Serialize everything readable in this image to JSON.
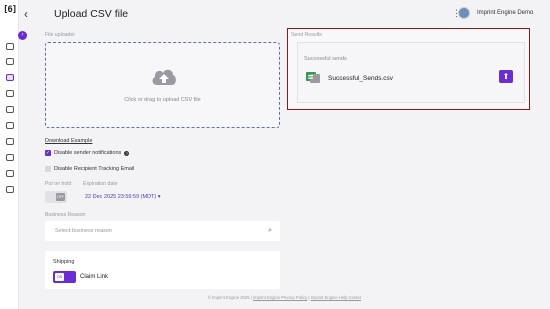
{
  "header": {
    "title": "Upload CSV file",
    "account_name": "Imprint Engine Demo",
    "logo_text": "[6]"
  },
  "sidebar": {
    "items": [
      "home-icon",
      "send-icon",
      "gift-icon",
      "box-icon",
      "truck-icon",
      "clipboard-icon",
      "users-icon",
      "globe-icon",
      "inbox-icon",
      "settings-icon"
    ]
  },
  "uploader": {
    "label": "File uploader",
    "prompt": "Click or drag to upload CSV file"
  },
  "send_results": {
    "label": "Send Results",
    "section_title": "Successful sends",
    "file_name": "Successful_Sends.csv"
  },
  "options": {
    "download_example": "Download Example",
    "disable_sender_notifications": "Disable sender notifications",
    "disable_tracking_email": "Disable Recipient Tracking Email",
    "put_on_hold_label": "Put on hold",
    "toggle_off_text": "OFF",
    "expiration_label": "Expiration date",
    "expiration_value": "22 Dec 2025 23:59:59 (MDT) ▾"
  },
  "business_reason": {
    "label": "Business Reason",
    "placeholder": "Select business reason"
  },
  "shipping": {
    "title": "Shipping",
    "toggle_on_text": "ON",
    "claim_link": "Claim Link"
  },
  "footer": {
    "copyright": "© Imprint Engine 2025",
    "privacy": "Imprint Engine Privacy Policy",
    "help": "Imprint Engine Help Center",
    "separator": "|"
  },
  "colors": {
    "accent": "#6a2bd9",
    "highlight_border": "#8b1b1b",
    "background": "#f3f3f6"
  }
}
